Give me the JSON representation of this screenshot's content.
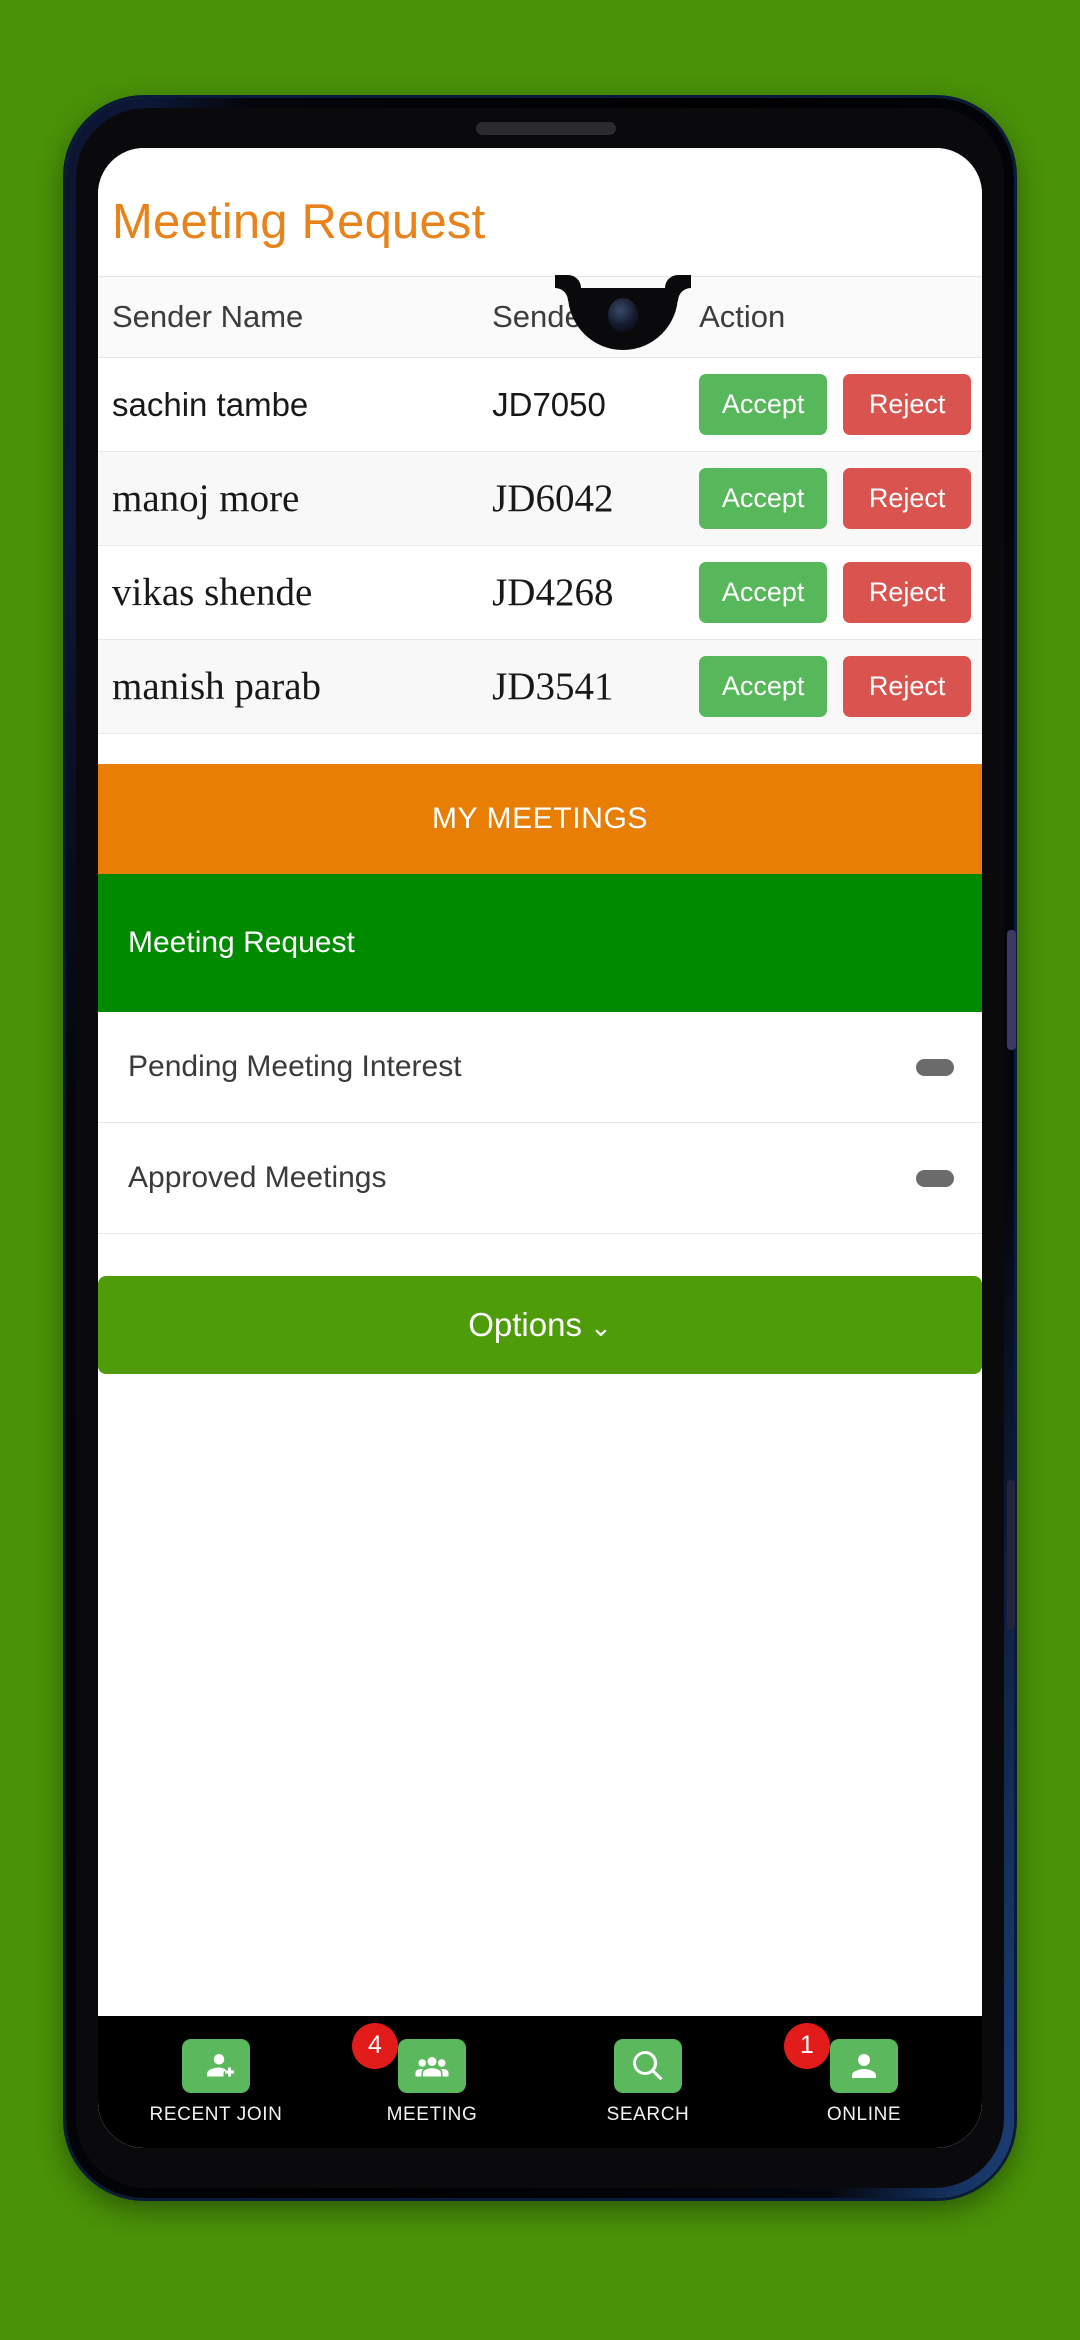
{
  "device": {
    "notch_style": "waterdrop",
    "background_color": "#4a9208",
    "bezel_color": "#0a0a0c"
  },
  "screen": {
    "page_title": "Meeting Request",
    "title_color": "#e8821a"
  },
  "requests_table": {
    "columns": [
      "Sender Name",
      "Sender ID",
      "Action"
    ],
    "accept_label": "Accept",
    "reject_label": "Reject",
    "accept_color": "#57b85b",
    "reject_color": "#d9534f",
    "rows": [
      {
        "name": "sachin tambe",
        "id": "JD7050",
        "font": "sans"
      },
      {
        "name": "manoj more",
        "id": "JD6042",
        "font": "serif"
      },
      {
        "name": "vikas shende",
        "id": "JD4268",
        "font": "serif"
      },
      {
        "name": "manish parab",
        "id": "JD3541",
        "font": "serif"
      }
    ]
  },
  "my_meetings": {
    "header": "MY MEETINGS",
    "header_color": "#e87e04",
    "active_color": "#008a00",
    "items": [
      {
        "label": "Meeting Request",
        "active": true,
        "badge": false
      },
      {
        "label": "Pending Meeting Interest",
        "active": false,
        "badge": true
      },
      {
        "label": "Approved Meetings",
        "active": false,
        "badge": true
      }
    ]
  },
  "options": {
    "label": "Options",
    "chevron": "⌄",
    "color": "#4e9c0a"
  },
  "bottom_nav": {
    "badge_color": "#e21b1b",
    "icon_color": "#5cb85c",
    "items": [
      {
        "label": "RECENT JOIN",
        "icon": "person-add-icon",
        "badge": ""
      },
      {
        "label": "MEETING",
        "icon": "people-group-icon",
        "badge": "4"
      },
      {
        "label": "SEARCH",
        "icon": "search-icon",
        "badge": ""
      },
      {
        "label": "ONLINE",
        "icon": "person-icon",
        "badge": "1"
      }
    ]
  }
}
